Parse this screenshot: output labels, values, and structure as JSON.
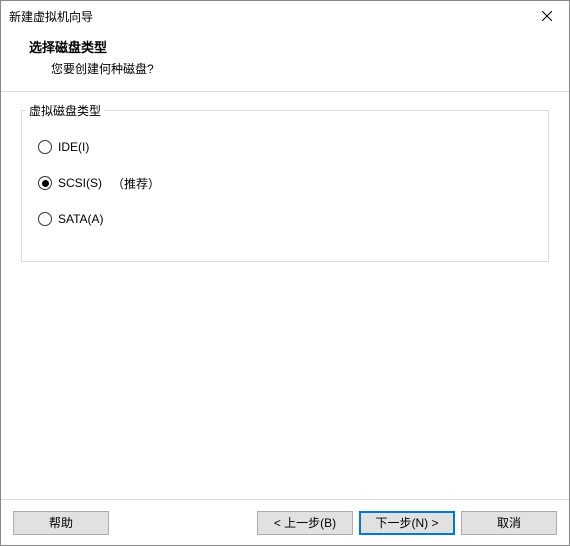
{
  "window": {
    "title": "新建虚拟机向导"
  },
  "header": {
    "title": "选择磁盘类型",
    "subtitle": "您要创建何种磁盘?"
  },
  "group": {
    "legend": "虚拟磁盘类型",
    "options": [
      {
        "label": "IDE(I)",
        "recommended": "",
        "selected": false
      },
      {
        "label": "SCSI(S)",
        "recommended": "（推荐）",
        "selected": true
      },
      {
        "label": "SATA(A)",
        "recommended": "",
        "selected": false
      }
    ]
  },
  "footer": {
    "help": "帮助",
    "back": "< 上一步(B)",
    "next": "下一步(N) >",
    "cancel": "取消"
  }
}
